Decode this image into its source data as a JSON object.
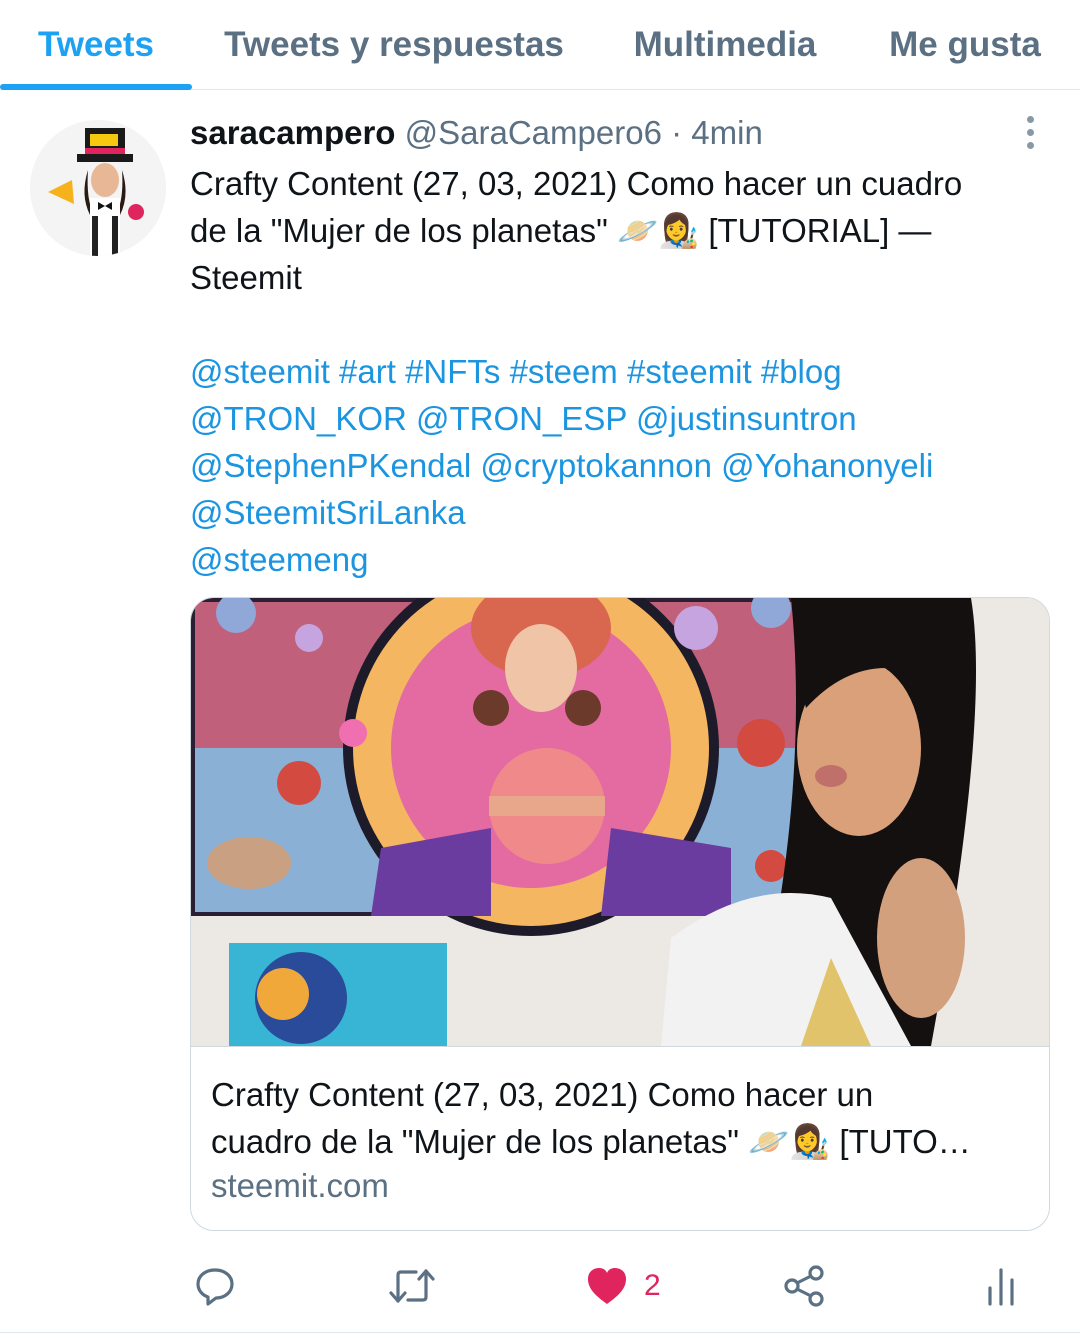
{
  "tabs": [
    {
      "label": "Tweets",
      "active": true
    },
    {
      "label": "Tweets y respuestas",
      "active": false
    },
    {
      "label": "Multimedia",
      "active": false
    },
    {
      "label": "Me gusta",
      "active": false
    }
  ],
  "tweet": {
    "display_name": "saracampero",
    "handle": "@SaraCampero6",
    "separator": "·",
    "time": "4min",
    "text_lines": [
      "Crafty Content (27, 03, 2021) Como hacer un cuadro",
      "de la \"Mujer de los planetas\" 🪐👩‍🎨  [TUTORIAL] —",
      "Steemit"
    ],
    "tag_lines": [
      "@steemit #art #NFTs #steem #steemit #blog",
      "@TRON_KOR @TRON_ESP @justinsuntron",
      "@StephenPKendal @cryptokannon @Yohanonyeli",
      "@SteemitSriLanka",
      "@steemeng"
    ],
    "card": {
      "title_lines": [
        "Crafty Content (27, 03, 2021) Como hacer un",
        "cuadro de la \"Mujer de los planetas\" 🪐👩‍🎨 [TUTO…"
      ],
      "domain": "steemit.com"
    },
    "actions": {
      "reply_icon": "reply-icon",
      "retweet_icon": "retweet-icon",
      "like_icon": "heart-icon",
      "like_count": "2",
      "share_icon": "share-icon",
      "analytics_icon": "analytics-icon",
      "liked": true
    }
  },
  "colors": {
    "accent": "#1da1f2",
    "link": "#1b95e0",
    "like": "#e0245e",
    "muted": "#5b7083"
  }
}
